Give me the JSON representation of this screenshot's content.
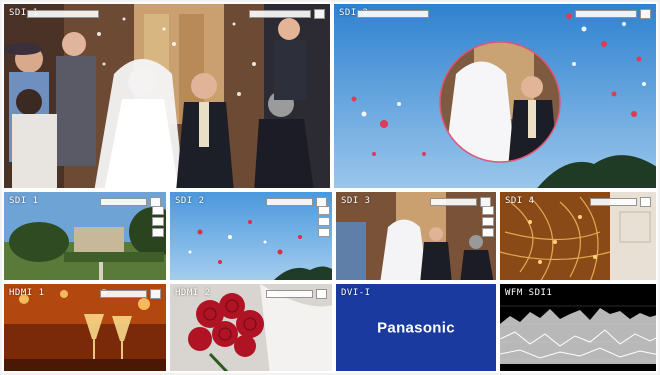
{
  "tiles": {
    "top_left": {
      "label": "SDI 1"
    },
    "top_right": {
      "label": "SDI 2"
    },
    "mid_1": {
      "label": "SDI 1"
    },
    "mid_2": {
      "label": "SDI 2"
    },
    "mid_3": {
      "label": "SDI 3"
    },
    "mid_4": {
      "label": "SDI 4"
    },
    "bot_1": {
      "label": "HDMI 1"
    },
    "bot_2": {
      "label": "HDMI 2"
    },
    "bot_3": {
      "label": "DVI-I",
      "brand_text": "Panasonic"
    },
    "bot_4": {
      "label": "WFM SDI1"
    }
  },
  "colors": {
    "frame": "#ffffff",
    "panasonic_blue": "#1a3aa0",
    "sky_blue": "#3d8fd6"
  },
  "icons": {
    "audio_meter": "white-meter-box"
  }
}
